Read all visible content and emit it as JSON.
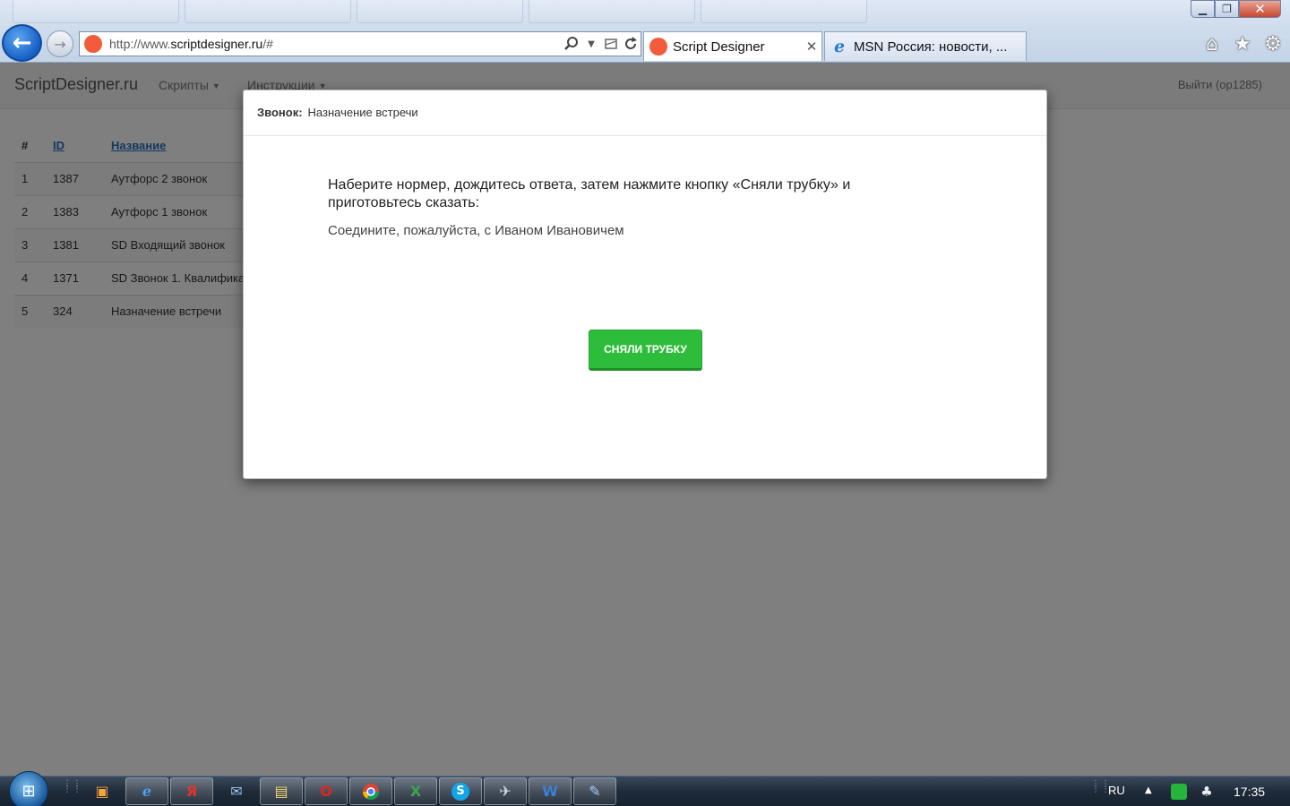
{
  "browser": {
    "url_prefix": "http://www.",
    "url_domain": "scriptdesigner.ru",
    "url_suffix": "/#",
    "tabs": [
      {
        "label": "Script Designer",
        "active": true
      },
      {
        "label": "MSN Россия: новости, ...",
        "active": false
      }
    ],
    "icons": {
      "back": "arrow-left-icon",
      "forward": "arrow-right-icon",
      "search": "search-icon",
      "refresh": "refresh-icon",
      "home": "home-icon",
      "favorites": "star-icon",
      "tools": "gear-icon"
    }
  },
  "navbar": {
    "brand": "ScriptDesigner.ru",
    "menu": [
      {
        "label": "Скрипты"
      },
      {
        "label": "Инструкции"
      }
    ],
    "logout": "Выйти (op1285)"
  },
  "table": {
    "headers": [
      "#",
      "ID",
      "Название"
    ],
    "rows": [
      {
        "num": "1",
        "id": "1387",
        "name": "Аутфорс 2 звонок"
      },
      {
        "num": "2",
        "id": "1383",
        "name": "Аутфорс 1 звонок"
      },
      {
        "num": "3",
        "id": "1381",
        "name": "SD Входящий звонок"
      },
      {
        "num": "4",
        "id": "1371",
        "name": "SD Звонок 1. Квалифика"
      },
      {
        "num": "5",
        "id": "324",
        "name": "Назначение встречи"
      }
    ]
  },
  "modal": {
    "header_label": "Звонок:",
    "header_title": "Назначение встречи",
    "instruction": "Наберите нормер, дождитесь ответа, затем нажмите кнопку «Сняли трубку» и приготовьтесь сказать:",
    "say_text": "Соедините, пожалуйста, с Иваном Ивановичем",
    "button": "СНЯЛИ ТРУБКУ",
    "button_color": "#2ebd3a"
  },
  "taskbar": {
    "language": "RU",
    "time": "17:35",
    "apps": [
      "media-player-icon",
      "internet-explorer-icon",
      "yandex-icon",
      "mail-icon",
      "file-explorer-icon",
      "opera-icon",
      "chrome-icon",
      "excel-icon",
      "skype-icon",
      "network-tool-icon",
      "word-icon",
      "notes-icon"
    ]
  }
}
